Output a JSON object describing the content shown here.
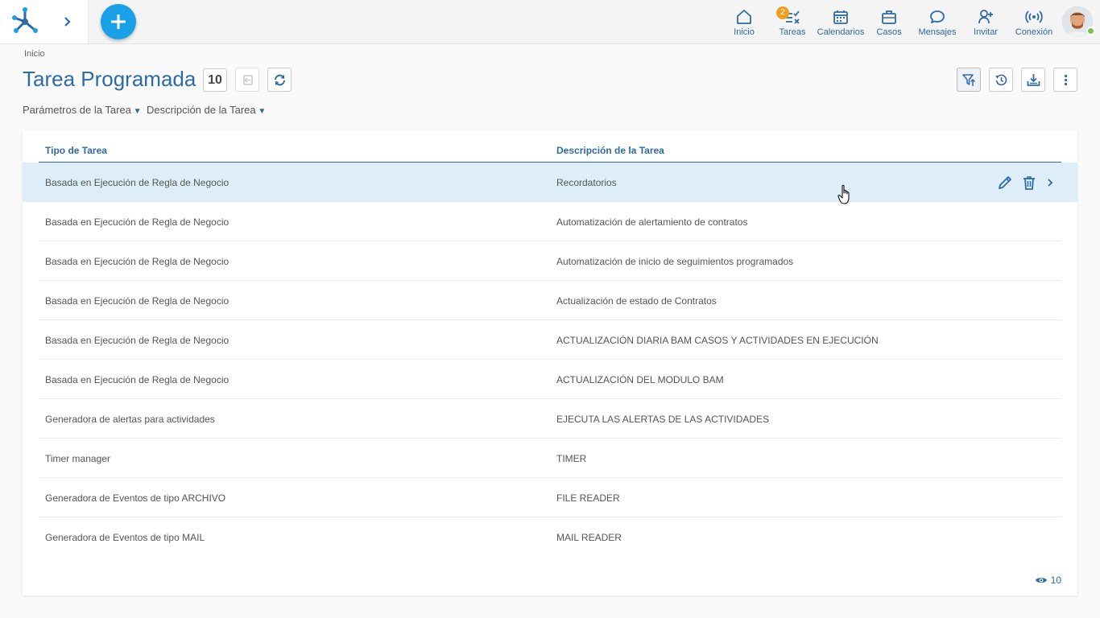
{
  "topbar": {
    "nav": [
      {
        "id": "inicio",
        "label": "Inicio",
        "icon": "home-icon"
      },
      {
        "id": "tareas",
        "label": "Tareas",
        "icon": "tasks-icon",
        "badge": "2"
      },
      {
        "id": "calendarios",
        "label": "Calendarios",
        "icon": "calendar-icon"
      },
      {
        "id": "casos",
        "label": "Casos",
        "icon": "briefcase-icon"
      },
      {
        "id": "mensajes",
        "label": "Mensajes",
        "icon": "chat-icon"
      },
      {
        "id": "invitar",
        "label": "Invitar",
        "icon": "invite-user-icon"
      },
      {
        "id": "conexion",
        "label": "Conexión",
        "icon": "broadcast-icon"
      }
    ]
  },
  "header": {
    "breadcrumb": "Inicio",
    "title": "Tarea Programada",
    "count": "10"
  },
  "filters": [
    {
      "label": "Parámetros de la Tarea"
    },
    {
      "label": "Descripción de la Tarea"
    }
  ],
  "table": {
    "columns": [
      "Tipo de Tarea",
      "Descripción de la Tarea"
    ],
    "rows": [
      {
        "tipo": "Basada en Ejecución de Regla de Negocio",
        "descripcion": "Recordatorios"
      },
      {
        "tipo": "Basada en Ejecución de Regla de Negocio",
        "descripcion": "Automatización de alertamiento de contratos"
      },
      {
        "tipo": "Basada en Ejecución de Regla de Negocio",
        "descripcion": "Automatización de inicio de seguimientos programados"
      },
      {
        "tipo": "Basada en Ejecución de Regla de Negocio",
        "descripcion": "Actualización de estado de Contratos"
      },
      {
        "tipo": "Basada en Ejecución de Regla de Negocio",
        "descripcion": "ACTUALIZACIÓN DIARIA BAM CASOS Y ACTIVIDADES EN EJECUCIÓN"
      },
      {
        "tipo": "Basada en Ejecución de Regla de Negocio",
        "descripcion": "ACTUALIZACIÓN DEL MODULO BAM"
      },
      {
        "tipo": "Generadora de alertas para actividades",
        "descripcion": "EJECUTA LAS ALERTAS DE LAS ACTIVIDADES"
      },
      {
        "tipo": "Timer manager",
        "descripcion": "TIMER"
      },
      {
        "tipo": "Generadora de Eventos de tipo ARCHIVO",
        "descripcion": "FILE READER"
      },
      {
        "tipo": "Generadora de Eventos de tipo MAIL",
        "descripcion": "MAIL READER"
      }
    ],
    "visible_count": "10"
  },
  "colors": {
    "accent": "#2d6aa8",
    "add_button": "#19a0e6",
    "row_hover": "#ddeef8",
    "badge": "#f0a01e"
  }
}
